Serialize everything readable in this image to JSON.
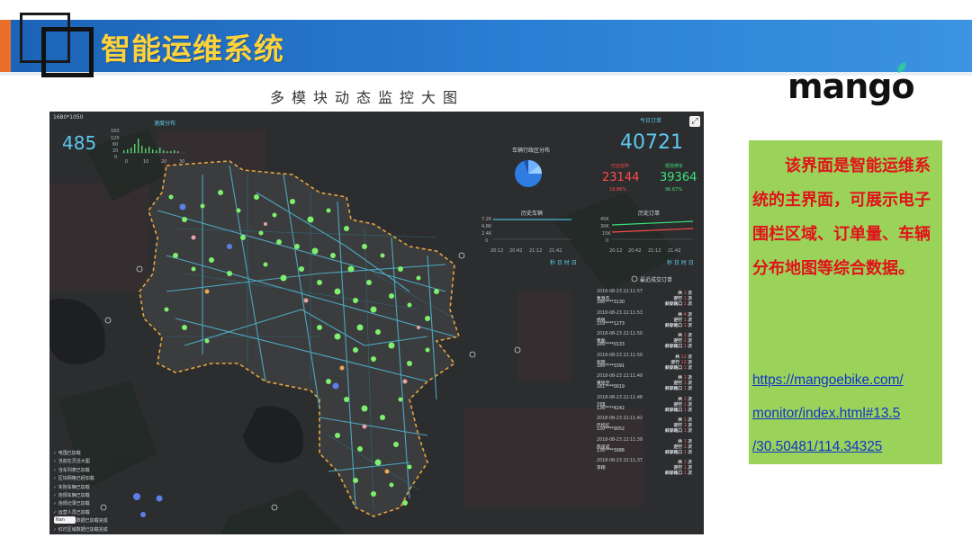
{
  "slide": {
    "title": "智能运维系统",
    "subtitle": "多模块动态监控大图",
    "brand": "mango",
    "description": "该界面是智能运维系统的主界面，可展示电子围栏区域、订单量、车辆分布地图等综合数据。",
    "link_lines": [
      "https://mangoebike.com/",
      "monitor/index.html#13.5",
      "/30.50481/114.34325"
    ],
    "colors": {
      "header": "#2a7fd4",
      "title": "#ffd23a",
      "accent": "#e8702a",
      "textbox_bg": "#9bd35a",
      "textbox_text": "#e0131a",
      "link": "#1235c9"
    }
  },
  "dashboard": {
    "resolution": "1680*1050",
    "speed_label": "速度分布",
    "vehicles_count": "485",
    "speed_y_ticks": [
      "160",
      "120",
      "60",
      "20",
      "0"
    ],
    "speed_x_ticks": [
      "0",
      "10",
      "20",
      "30"
    ],
    "region_label": "车辆行政区分布",
    "today_label": "今日订单",
    "today_orders": "40721",
    "unlocked_label": "已还完毕",
    "unlocked_value": "23144",
    "unlocked_pct": "18.86%",
    "parked_label": "规范停车",
    "parked_value": "39364",
    "parked_pct": "96.67%",
    "history_vehicles_label": "历史车辆",
    "history_orders_label": "历史订单",
    "hist_left_y": [
      "7.2K",
      "4.8K",
      "2.4K",
      "0"
    ],
    "hist_right_y": [
      "45K",
      "30K",
      "15K",
      "0"
    ],
    "hist_x": [
      "20:12",
      "20:42",
      "21:12",
      "21:42"
    ],
    "hist_footer": "秒 日 时 日",
    "recent_orders_label": "最近成交订单",
    "close_icon": "expand-icon",
    "orders": [
      {
        "time": "2018-08-23 22:11:57",
        "name": "曹激杰",
        "phone": "186****3130",
        "count": "1",
        "rule": "1",
        "mode": "1"
      },
      {
        "time": "2018-08-23 22:11:53",
        "name": "杨佩",
        "phone": "159****1273",
        "count": "4",
        "rule": "1",
        "mode": "1"
      },
      {
        "time": "2018-08-23 22:11:50",
        "name": "曹磊",
        "phone": "186****0133",
        "count": "1",
        "rule": "1",
        "mode": "1"
      },
      {
        "time": "2018-08-23 22:11:50",
        "name": "程晓",
        "phone": "186****3391",
        "count": "12",
        "rule": "12",
        "mode": "1"
      },
      {
        "time": "2018-08-23 22:11:49",
        "name": "黄铭宇",
        "phone": "181****0019",
        "count": "1",
        "rule": "1",
        "mode": "1"
      },
      {
        "time": "2018-08-23 22:11:48",
        "name": "刘琪",
        "phone": "136****4242",
        "count": "1",
        "rule": "1",
        "mode": "1"
      },
      {
        "time": "2018-08-23 22:11:42",
        "name": "严桂红",
        "phone": "150****9052",
        "count": "1",
        "rule": "1",
        "mode": "1"
      },
      {
        "time": "2018-08-23 22:11:39",
        "name": "陈俊成",
        "phone": "136****3086",
        "count": "1",
        "rule": "1",
        "mode": "1"
      },
      {
        "time": "2018-08-23 22:11:37",
        "name": "李翔",
        "phone": "",
        "count": "1",
        "rule": "1",
        "mode": "1"
      }
    ],
    "order_labels": {
      "count": "共",
      "rule": "逆行",
      "mode": "斜穿路口",
      "unit": "次"
    },
    "legend_items": [
      "电围已加载",
      "当前在灵活大图",
      "当车列表已加载",
      "区块网格已经加载",
      "实际车辆已加载",
      "违规车辆已加载",
      "违规记录已加载",
      "运营人员已加载",
      "车辆状态数据已加载完成",
      "红灯区域数据已加载完成"
    ],
    "select_label": "Nan"
  }
}
